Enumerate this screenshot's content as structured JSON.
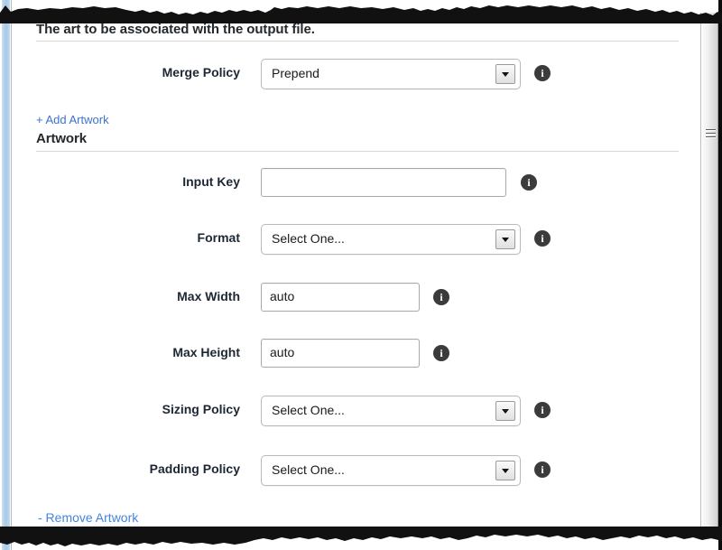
{
  "panel": {
    "section_heading": "The art to be associated with the output file.",
    "artwork_heading": "Artwork",
    "add_artwork_link": "+ Add Artwork",
    "remove_artwork_link": "- Remove Artwork",
    "info_glyph": "i",
    "accent_link_color": "#3b73d1",
    "info_icon_color": "#3b3b3b",
    "left_stripe_color": "#b7d2ec"
  },
  "fields": {
    "merge_policy": {
      "label": "Merge Policy",
      "value": "Prepend",
      "control": "select",
      "info": "i"
    },
    "input_key": {
      "label": "Input Key",
      "value": "",
      "placeholder": "",
      "control": "text",
      "info": "i"
    },
    "format": {
      "label": "Format",
      "value": "Select One...",
      "control": "select",
      "info": "i"
    },
    "max_width": {
      "label": "Max Width",
      "value": "auto",
      "control": "text",
      "info": "i"
    },
    "max_height": {
      "label": "Max Height",
      "value": "auto",
      "control": "text",
      "info": "i"
    },
    "sizing_policy": {
      "label": "Sizing Policy",
      "value": "Select One...",
      "control": "select",
      "info": "i"
    },
    "padding_policy": {
      "label": "Padding Policy",
      "value": "Select One...",
      "control": "select",
      "info": "i"
    }
  }
}
